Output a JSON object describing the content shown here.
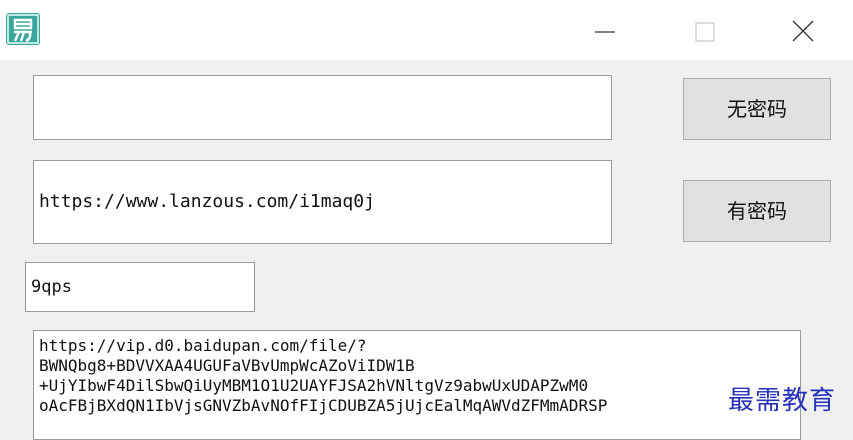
{
  "window": {
    "app_icon": "yi-app-icon",
    "controls": [
      "minimize-icon",
      "maximize-icon",
      "close-icon"
    ]
  },
  "inputs": {
    "field1_value": "",
    "link_value": "https://www.lanzous.com/i1maq0j",
    "password_value": "9qps",
    "output_value": "https://vip.d0.baidupan.com/file/?\nBWNQbg8+BDVVXAA4UGUFaVBvUmpWcAZoViIDW1B\n+UjYIbwF4DilSbwQiUyMBM1O1U2UAYFJSA2hVNltgVz9abwUxUDAPZwM0\noAcFBjBXdQN1IbVjsGNVZbAvNOfFIjCDUBZA5jUjcEalMqAWVdZFMmADRSP"
  },
  "buttons": {
    "no_password": "无密码",
    "with_password": "有密码"
  },
  "watermark": "最需教育",
  "colors": {
    "app_icon": "#3aa79a",
    "watermark": "#2431b8",
    "button_bg": "#e1e1e1"
  }
}
